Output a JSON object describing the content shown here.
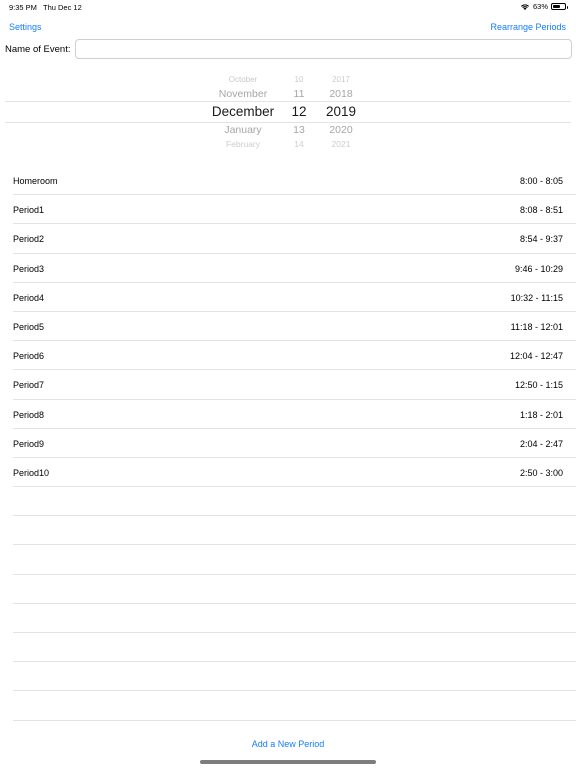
{
  "status_bar": {
    "time": "9:35 PM",
    "date": "Thu Dec 12",
    "battery_percent": "63%",
    "battery_level": 0.63
  },
  "nav": {
    "settings_label": "Settings",
    "rearrange_label": "Rearrange Periods"
  },
  "event": {
    "label": "Name of Event:",
    "value": "",
    "placeholder": ""
  },
  "date_picker": {
    "months": [
      "October",
      "November",
      "December",
      "January",
      "February"
    ],
    "days": [
      "10",
      "11",
      "12",
      "13",
      "14"
    ],
    "years": [
      "2017",
      "2018",
      "2019",
      "2020",
      "2021"
    ],
    "selected_index": 2
  },
  "periods": [
    {
      "name": "Homeroom",
      "time": "8:00 - 8:05"
    },
    {
      "name": "Period1",
      "time": "8:08 - 8:51"
    },
    {
      "name": "Period2",
      "time": "8:54 - 9:37"
    },
    {
      "name": "Period3",
      "time": "9:46 - 10:29"
    },
    {
      "name": "Period4",
      "time": "10:32 - 11:15"
    },
    {
      "name": "Period5",
      "time": "11:18 - 12:01"
    },
    {
      "name": "Period6",
      "time": "12:04 - 12:47"
    },
    {
      "name": "Period7",
      "time": "12:50 - 1:15"
    },
    {
      "name": "Period8",
      "time": "1:18 - 2:01"
    },
    {
      "name": "Period9",
      "time": "2:04 - 2:47"
    },
    {
      "name": "Period10",
      "time": "2:50 - 3:00"
    }
  ],
  "add_period_label": "Add a New Period",
  "colors": {
    "accent": "#147efb",
    "separator": "#e3e3e3"
  },
  "icons": [
    "wifi-icon",
    "battery-icon"
  ]
}
